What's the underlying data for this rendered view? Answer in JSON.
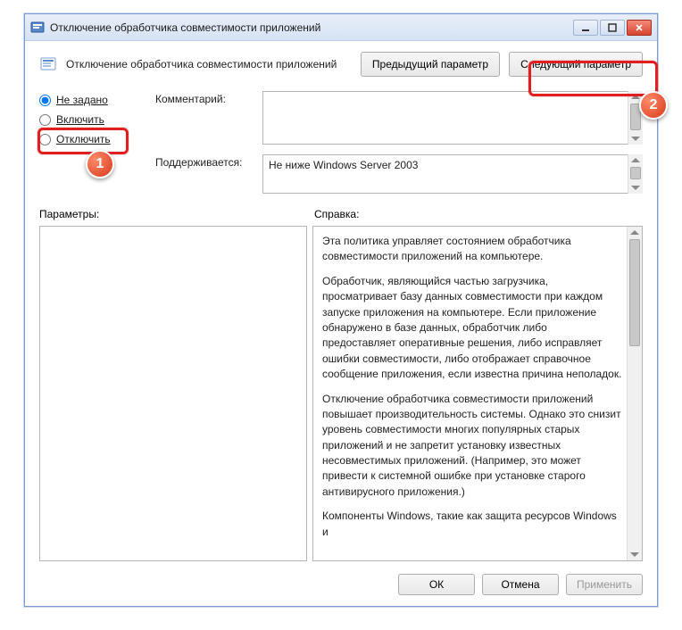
{
  "window": {
    "title": "Отключение обработчика совместимости приложений"
  },
  "header": {
    "title": "Отключение обработчика совместимости приложений",
    "prev_btn": "Предыдущий параметр",
    "next_btn": "Следующий параметр"
  },
  "radios": {
    "not_configured": "Не задано",
    "enabled": "Включить",
    "disabled": "Отключить"
  },
  "labels": {
    "comment": "Комментарий:",
    "supported": "Поддерживается:",
    "params": "Параметры:",
    "help": "Справка:"
  },
  "supported_text": "Не ниже Windows Server 2003",
  "help": {
    "p1": "Эта политика управляет состоянием обработчика совместимости приложений на компьютере.",
    "p2": "Обработчик, являющийся частью загрузчика, просматривает базу данных совместимости при каждом запуске приложения на компьютере.  Если приложение обнаружено в базе данных, обработчик либо предоставляет оперативные решения, либо исправляет ошибки совместимости, либо отображает справочное сообщение приложения, если известна причина неполадок.",
    "p3": "Отключение обработчика совместимости приложений повышает производительность системы. Однако это снизит уровень совместимости многих популярных старых приложений и не запретит установку известных несовместимых приложений. (Например, это может привести к системной ошибке при установке старого антивирусного приложения.)",
    "p4": "Компоненты Windows, такие как защита ресурсов Windows и"
  },
  "buttons": {
    "ok": "ОК",
    "cancel": "Отмена",
    "apply": "Применить"
  },
  "badges": {
    "one": "1",
    "two": "2"
  }
}
